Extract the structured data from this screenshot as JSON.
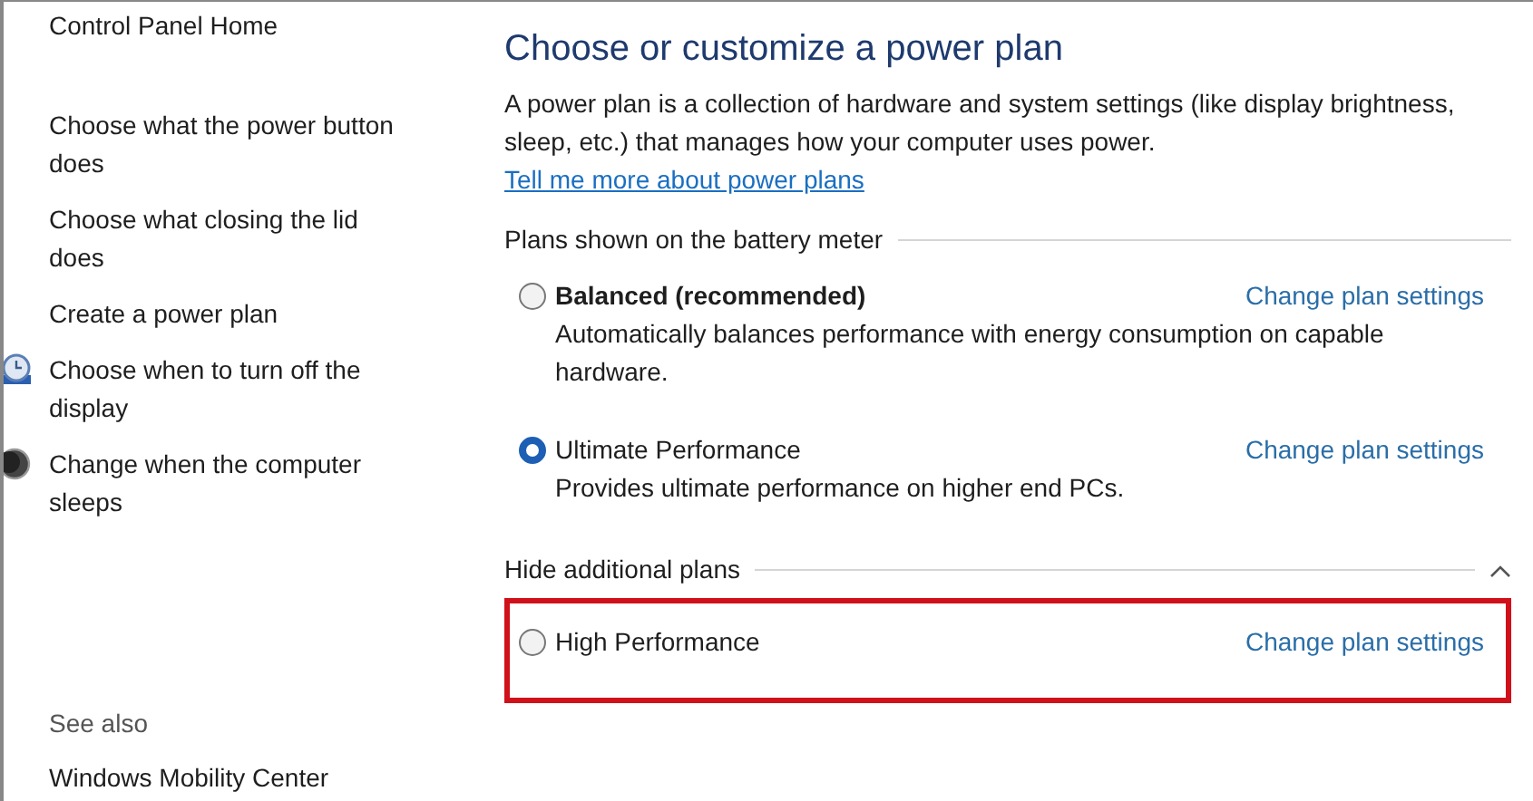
{
  "sidebar": {
    "home": "Control Panel Home",
    "items": [
      {
        "label": "Choose what the power button does",
        "kind": "plain"
      },
      {
        "label": "Choose what closing the lid does",
        "kind": "plain"
      },
      {
        "label": "Create a power plan",
        "kind": "plain"
      },
      {
        "label": "Choose when to turn off the display",
        "kind": "display"
      },
      {
        "label": "Change when the computer sleeps",
        "kind": "sleep"
      }
    ],
    "see_also": "See also",
    "see_also_items": [
      "Windows Mobility Center"
    ]
  },
  "main": {
    "title": "Choose or customize a power plan",
    "intro": "A power plan is a collection of hardware and system settings (like display brightness, sleep, etc.) that manages how your computer uses power.",
    "intro_link": "Tell me more about power plans",
    "groups": [
      {
        "label": "Plans shown on the battery meter",
        "plans": [
          {
            "name": "Balanced (recommended)",
            "bold": true,
            "selected": false,
            "highlighted": false,
            "description": "Automatically balances performance with energy consumption on capable hardware.",
            "link": "Change plan settings"
          },
          {
            "name": "Ultimate Performance",
            "bold": false,
            "selected": true,
            "highlighted": false,
            "description": "Provides ultimate performance on higher end PCs.",
            "link": "Change plan settings"
          }
        ]
      },
      {
        "label": "Hide additional plans",
        "expanded": true,
        "plans": [
          {
            "name": "High Performance",
            "bold": false,
            "selected": false,
            "highlighted": true,
            "link": "Change plan settings"
          }
        ]
      }
    ]
  }
}
